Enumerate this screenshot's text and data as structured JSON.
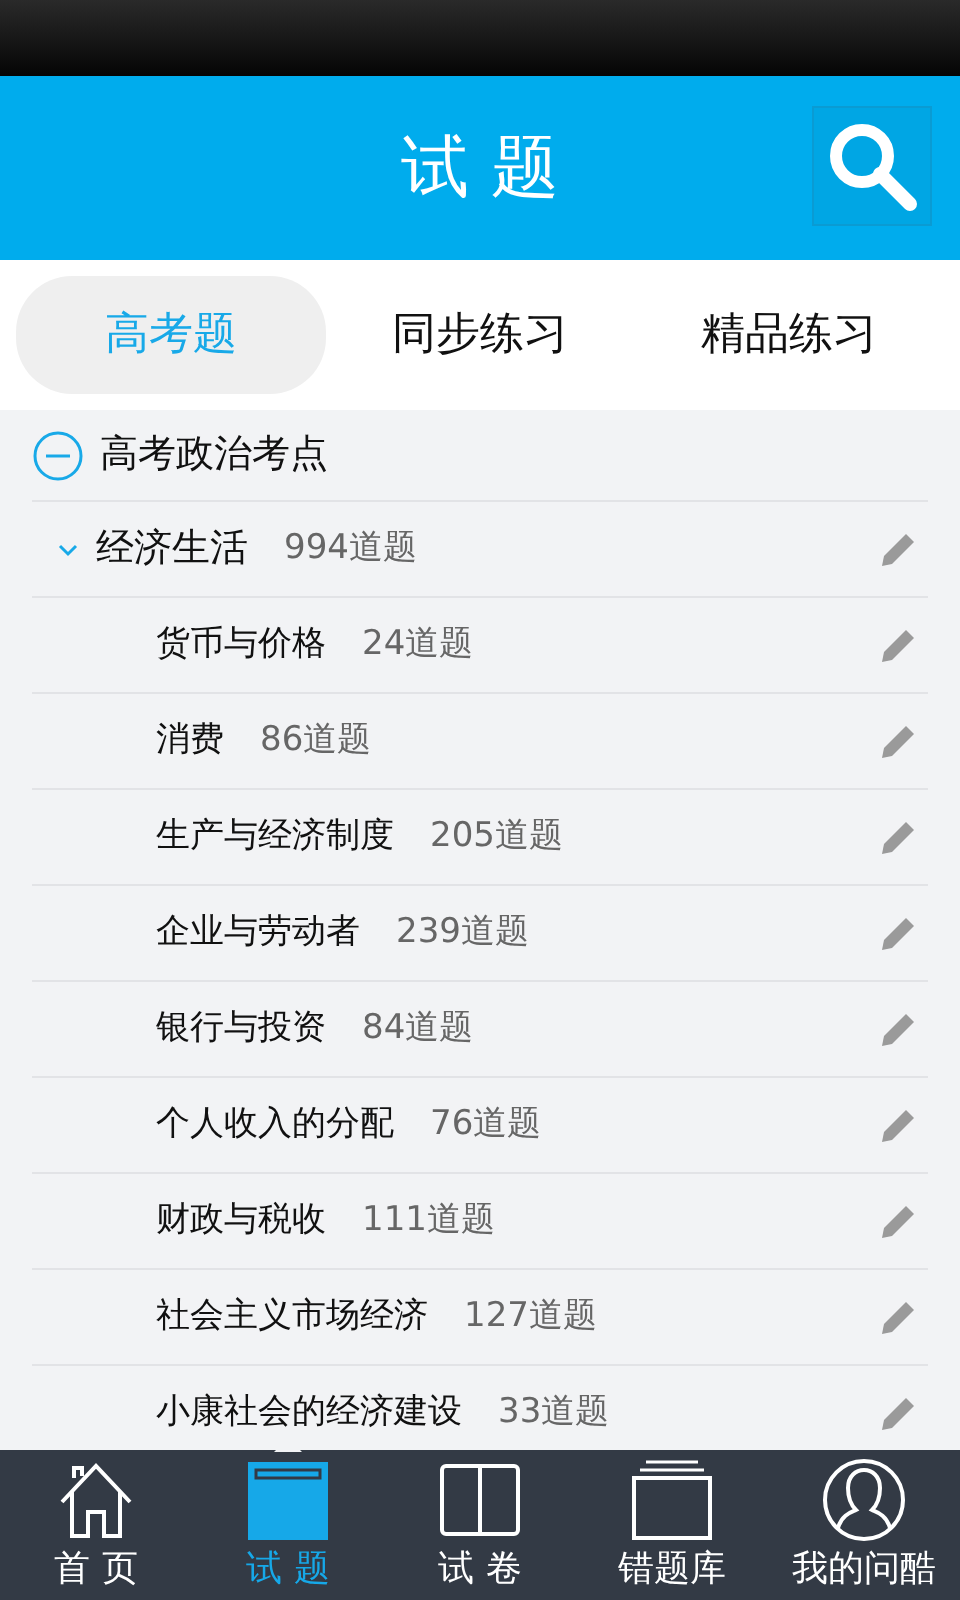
{
  "header": {
    "title": "试 题"
  },
  "tabs": [
    {
      "label": "高考题",
      "selected": true
    },
    {
      "label": "同步练习",
      "selected": false
    },
    {
      "label": "精品练习",
      "selected": false
    }
  ],
  "tree": {
    "label": "高考政治考点",
    "expanded": true,
    "children": [
      {
        "label": "经济生活",
        "count": "994道题",
        "expanded": true,
        "children": [
          {
            "label": "货币与价格",
            "count": "24道题"
          },
          {
            "label": "消费",
            "count": "86道题"
          },
          {
            "label": "生产与经济制度",
            "count": "205道题"
          },
          {
            "label": "企业与劳动者",
            "count": "239道题"
          },
          {
            "label": "银行与投资",
            "count": "84道题"
          },
          {
            "label": "个人收入的分配",
            "count": "76道题"
          },
          {
            "label": "财政与税收",
            "count": "111道题"
          },
          {
            "label": "社会主义市场经济",
            "count": "127道题"
          },
          {
            "label": "小康社会的经济建设",
            "count": "33道题"
          }
        ]
      }
    ]
  },
  "bottom_nav": [
    {
      "label": "首 页",
      "selected": false
    },
    {
      "label": "试 题",
      "selected": true
    },
    {
      "label": "试 卷",
      "selected": false
    },
    {
      "label": "错题库",
      "selected": false
    },
    {
      "label": "我的问酷",
      "selected": false
    }
  ]
}
